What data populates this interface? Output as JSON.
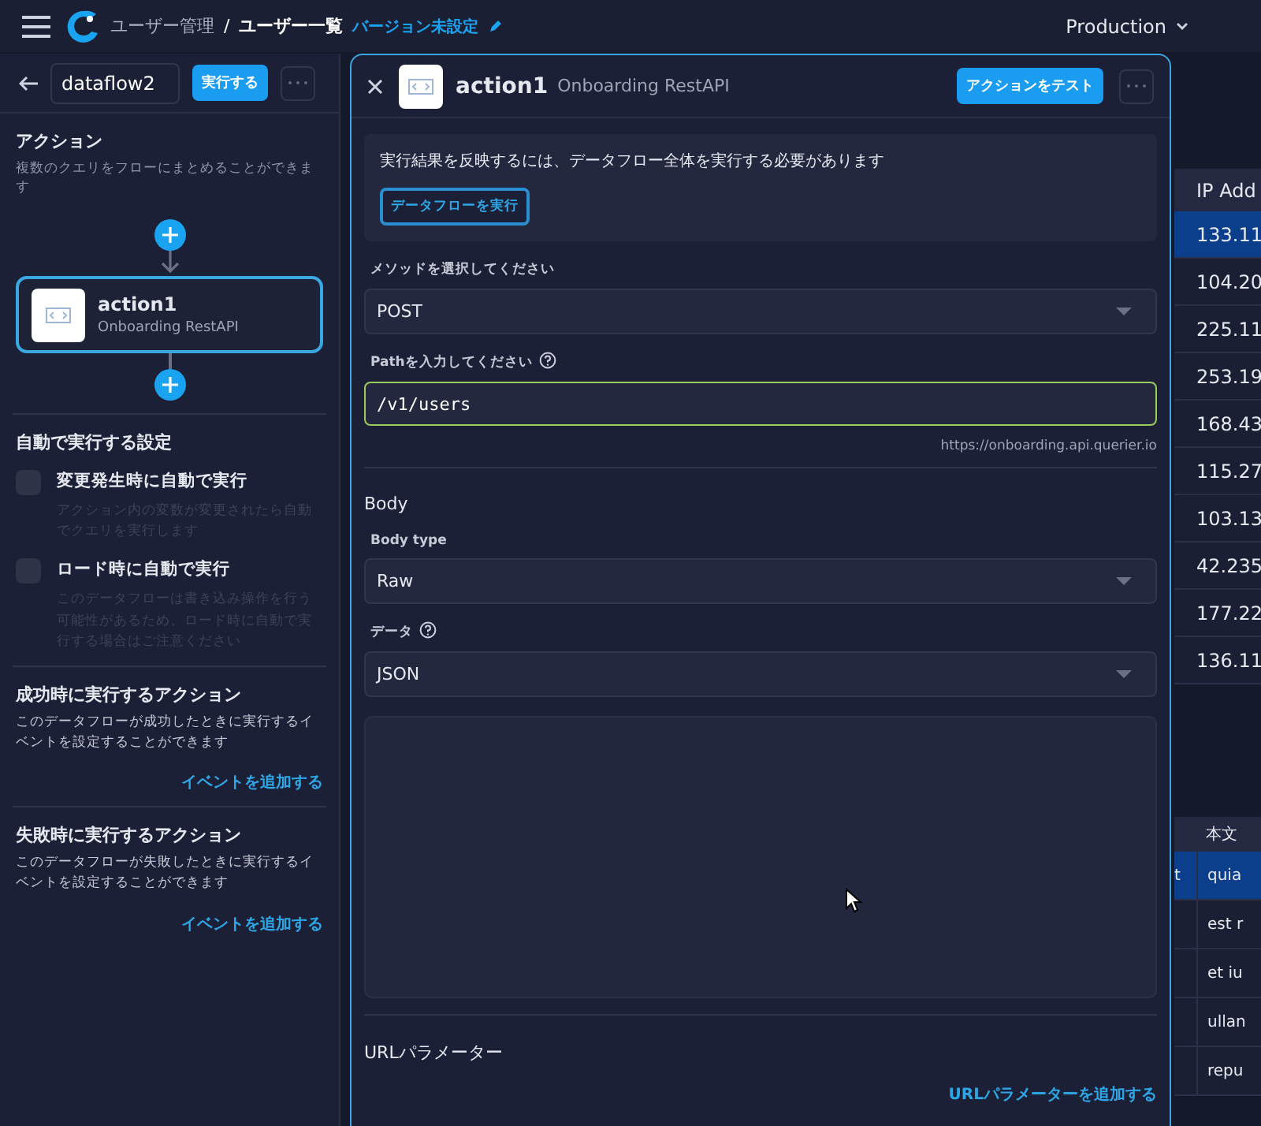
{
  "topbar": {
    "breadcrumb_parent": "ユーザー管理",
    "separator": "/",
    "breadcrumb_current": "ユーザー一覧",
    "version_link": "バージョン未設定",
    "environment": "Production"
  },
  "sidebar": {
    "name_value": "dataflow2",
    "run_button": "実行する",
    "actions_title": "アクション",
    "actions_desc": "複数のクエリをフローにまとめることができます",
    "action_cards": [
      {
        "title": "action1",
        "subtitle": "Onboarding RestAPI",
        "selected": true
      }
    ],
    "auto_title": "自動で実行する設定",
    "auto_options": [
      {
        "label": "変更発生時に自動で実行",
        "description": "アクション内の変数が変更されたら自動でクエリを実行します",
        "checked": false
      },
      {
        "label": "ロード時に自動で実行",
        "description": "このデータフローは書き込み操作を行う可能性があるため、ロード時に自動で実行する場合はご注意ください",
        "checked": false
      }
    ],
    "event_sections": [
      {
        "title": "成功時に実行するアクション",
        "description": "このデータフローが成功したときに実行するイベントを設定することができます",
        "link": "イベントを追加する"
      },
      {
        "title": "失敗時に実行するアクション",
        "description": "このデータフローが失敗したときに実行するイベントを設定することができます",
        "link": "イベントを追加する"
      }
    ]
  },
  "panel": {
    "title": "action1",
    "subtitle": "Onboarding RestAPI",
    "test_button": "アクションをテスト",
    "notice": "実行結果を反映するには、データフロー全体を実行する必要があります",
    "notice_button": "データフローを実行",
    "method": {
      "label": "メソッドを選択してください",
      "value": "POST"
    },
    "path": {
      "label": "Pathを入力してください",
      "value": "/v1/users",
      "hint": "https://onboarding.api.querier.io"
    },
    "body": {
      "title": "Body",
      "type": {
        "label": "Body type",
        "value": "Raw"
      },
      "data": {
        "label": "データ",
        "value": "JSON"
      }
    },
    "url_params": {
      "title": "URLパラメーター",
      "link": "URLパラメーターを追加する"
    }
  },
  "background_tables": [
    {
      "header": "IP Add",
      "rows": [
        {
          "text": "133.11",
          "selected": true
        },
        {
          "text": "104.20",
          "selected": false
        },
        {
          "text": "225.11",
          "selected": false
        },
        {
          "text": "253.19",
          "selected": false
        },
        {
          "text": "168.43",
          "selected": false
        },
        {
          "text": "115.27",
          "selected": false
        },
        {
          "text": "103.13",
          "selected": false
        },
        {
          "text": "42.235",
          "selected": false
        },
        {
          "text": "177.22",
          "selected": false
        },
        {
          "text": "136.11",
          "selected": false
        }
      ]
    },
    {
      "header": "本文",
      "rows": [
        {
          "lead": "t",
          "text": "quia",
          "selected": true
        },
        {
          "text": "est r",
          "selected": false
        },
        {
          "text": "et iu",
          "selected": false
        },
        {
          "text": "ullan",
          "selected": false
        },
        {
          "text": "repu",
          "selected": false
        }
      ]
    }
  ]
}
